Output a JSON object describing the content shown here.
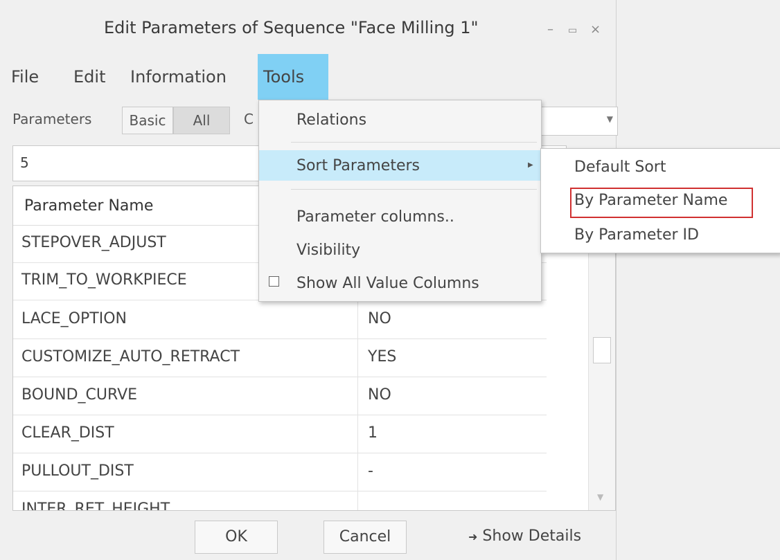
{
  "window": {
    "title": "Edit Parameters of Sequence \"Face Milling 1\"",
    "minimize_glyph": "–",
    "maximize_glyph": "▭",
    "close_glyph": "×"
  },
  "menubar": {
    "items": [
      "File",
      "Edit",
      "Information",
      "Tools"
    ],
    "active": "Tools"
  },
  "toolbar": {
    "parameters_label": "Parameters",
    "basic_label": "Basic",
    "all_label": "All",
    "partial_label": "C",
    "selected": "All"
  },
  "filter": {
    "value": "5"
  },
  "grid": {
    "header": "Parameter Name",
    "rows": [
      {
        "name": "STEPOVER_ADJUST",
        "value": ""
      },
      {
        "name": "TRIM_TO_WORKPIECE",
        "value": ""
      },
      {
        "name": "LACE_OPTION",
        "value": "NO"
      },
      {
        "name": "CUSTOMIZE_AUTO_RETRACT",
        "value": "YES"
      },
      {
        "name": "BOUND_CURVE",
        "value": "NO"
      },
      {
        "name": "CLEAR_DIST",
        "value": "1"
      },
      {
        "name": "PULLOUT_DIST",
        "value": "-"
      },
      {
        "name": "INTER_RET_HEIGHT",
        "value": ""
      }
    ]
  },
  "tools_menu": {
    "items": [
      {
        "label": "Relations"
      },
      {
        "label": "Sort Parameters",
        "has_submenu": true,
        "highlighted": true
      },
      {
        "label": "Parameter columns.."
      },
      {
        "label": "Visibility"
      },
      {
        "label": "Show All Value Columns",
        "checkbox": true,
        "checked": false
      }
    ]
  },
  "sort_submenu": {
    "items": [
      "Default Sort",
      "By Parameter Name",
      "By Parameter ID"
    ],
    "highlighted_box": "By Parameter Name",
    "highlight_color": "#d03030"
  },
  "footer": {
    "ok_label": "OK",
    "cancel_label": "Cancel",
    "details_arrow": "➜",
    "details_label": "Show Details"
  },
  "colors": {
    "menu_active": "#80d0f4",
    "menu_hover": "#c8ebfa"
  }
}
